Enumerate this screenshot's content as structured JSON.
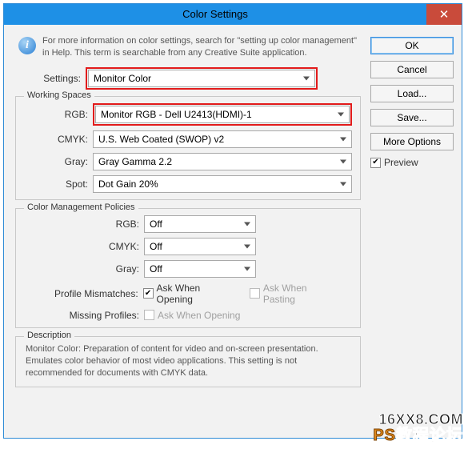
{
  "window": {
    "title": "Color Settings"
  },
  "info": {
    "text": "For more information on color settings, search for \"setting up color management\" in Help. This term is searchable from any Creative Suite application."
  },
  "settings": {
    "label": "Settings:",
    "value": "Monitor Color"
  },
  "workingSpaces": {
    "legend": "Working Spaces",
    "rgb": {
      "label": "RGB:",
      "value": "Monitor RGB - Dell U2413(HDMI)-1"
    },
    "cmyk": {
      "label": "CMYK:",
      "value": "U.S. Web Coated (SWOP) v2"
    },
    "gray": {
      "label": "Gray:",
      "value": "Gray Gamma 2.2"
    },
    "spot": {
      "label": "Spot:",
      "value": "Dot Gain 20%"
    }
  },
  "policies": {
    "legend": "Color Management Policies",
    "rgb": {
      "label": "RGB:",
      "value": "Off"
    },
    "cmyk": {
      "label": "CMYK:",
      "value": "Off"
    },
    "gray": {
      "label": "Gray:",
      "value": "Off"
    },
    "mismatch_label": "Profile Mismatches:",
    "mismatch_open": "Ask When Opening",
    "mismatch_paste": "Ask When Pasting",
    "missing_label": "Missing Profiles:",
    "missing_open": "Ask When Opening"
  },
  "description": {
    "legend": "Description",
    "text": "Monitor Color:  Preparation of content for video and on-screen presentation. Emulates color behavior of most video applications. This setting is not recommended for documents with CMYK data."
  },
  "buttons": {
    "ok": "OK",
    "cancel": "Cancel",
    "load": "Load...",
    "save": "Save...",
    "more": "More Options"
  },
  "preview": {
    "label": "Preview"
  },
  "watermark": {
    "line1": "16XX8.COM",
    "line2a": "PS",
    "line2b": "教程论坛"
  }
}
